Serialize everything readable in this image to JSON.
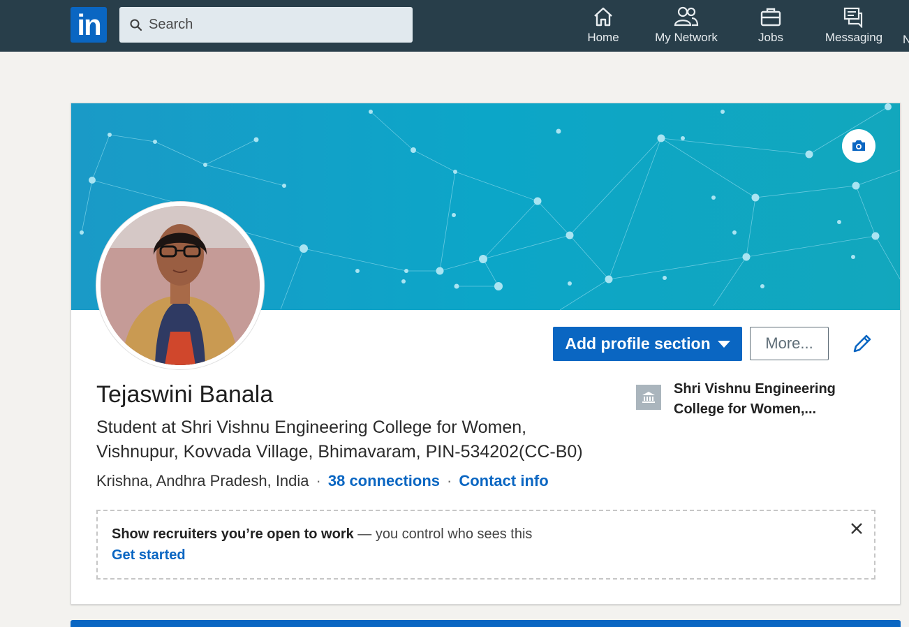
{
  "nav": {
    "logo": "in",
    "search_placeholder": "Search",
    "items": [
      {
        "label": "Home",
        "icon": "home-icon"
      },
      {
        "label": "My Network",
        "icon": "people-icon"
      },
      {
        "label": "Jobs",
        "icon": "briefcase-icon"
      },
      {
        "label": "Messaging",
        "icon": "messaging-icon"
      }
    ],
    "overflow_label": "N"
  },
  "profile": {
    "name": "Tejaswini Banala",
    "headline": "Student at Shri Vishnu Engineering College for Women, Vishnupur, Kovvada Village, Bhimavaram, PIN-534202(CC-B0)",
    "location": "Krishna, Andhra Pradesh, India",
    "connections": "38 connections",
    "contact_info": "Contact info",
    "education": "Shri Vishnu Engineering College for Women,..."
  },
  "actions": {
    "add_section": "Add profile section",
    "more": "More..."
  },
  "open_to_work": {
    "bold": "Show recruiters you’re open to work",
    "rest": " — you control who sees this",
    "link": "Get started"
  },
  "colors": {
    "nav_bg": "#283e4a",
    "brand": "#0a66c2",
    "banner": "#0ca6c8"
  }
}
